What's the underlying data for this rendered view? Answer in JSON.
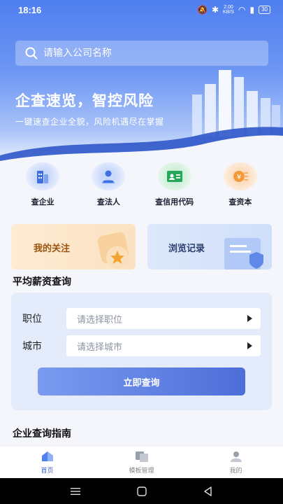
{
  "status_bar": {
    "time": "18:16",
    "speed_value": "2.00",
    "speed_unit": "KB/S",
    "battery": "30"
  },
  "search": {
    "placeholder": "请输入公司名称"
  },
  "hero": {
    "title": "企查速览，智控风险",
    "subtitle": "一键速查企业全貌，风险机遇尽在掌握"
  },
  "quick_actions": [
    {
      "label": "查企业",
      "icon": "building-icon"
    },
    {
      "label": "查法人",
      "icon": "person-icon"
    },
    {
      "label": "查信用代码",
      "icon": "id-card-icon"
    },
    {
      "label": "查资本",
      "icon": "yuan-coin-icon"
    }
  ],
  "cards": {
    "follow": "我的关注",
    "history": "浏览记录"
  },
  "salary": {
    "section_title": "平均薪资查询",
    "position_label": "职位",
    "position_placeholder": "请选择职位",
    "city_label": "城市",
    "city_placeholder": "请选择城市",
    "query_button": "立即查询"
  },
  "guide": {
    "section_title": "企业查询指南"
  },
  "tabbar": [
    {
      "label": "首页",
      "icon": "home-icon",
      "active": true
    },
    {
      "label": "模板管理",
      "icon": "template-icon",
      "active": false
    },
    {
      "label": "我的",
      "icon": "profile-icon",
      "active": false
    }
  ],
  "colors": {
    "primary": "#4f7ff0",
    "accent": "#3e63d6",
    "orange": "#9a5410"
  }
}
